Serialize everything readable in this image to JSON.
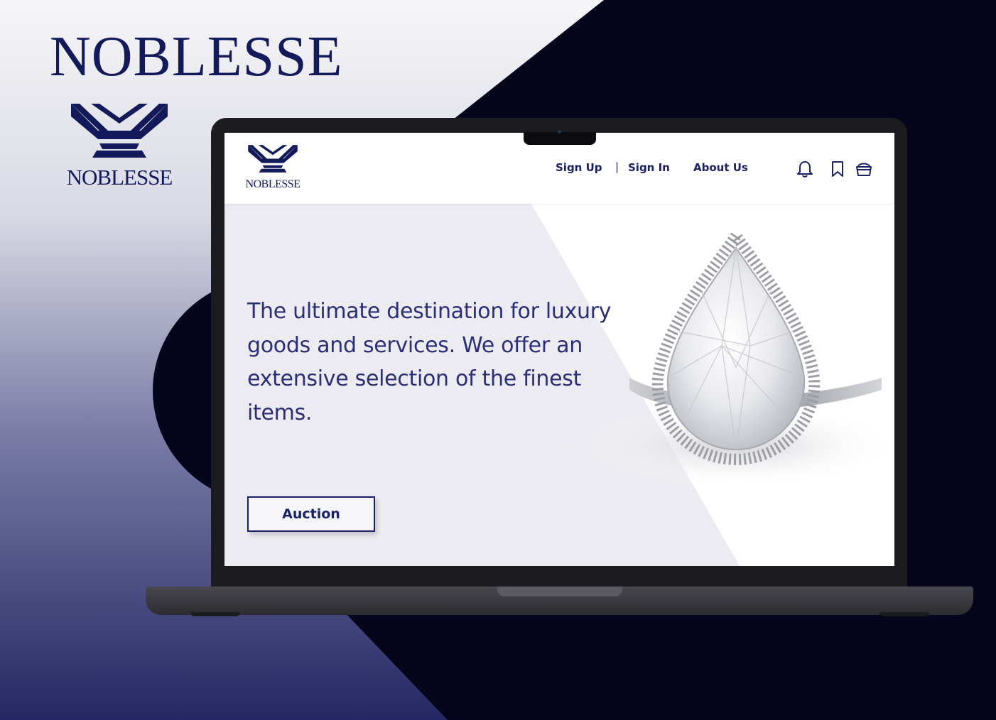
{
  "brand": {
    "title": "NOBLESSE",
    "logo_text": "NOBLESSE"
  },
  "site": {
    "logo_text": "NOBLESSE",
    "nav": {
      "sign_up": "Sign  Up",
      "separator": "|",
      "sign_in": "Sign In",
      "about": "About Us"
    },
    "icons": [
      "bell-icon",
      "bookmark-icon",
      "cart-icon"
    ],
    "hero_text": "The ultimate destination for luxury goods and services. We offer an extensive selection of the finest items.",
    "cta_label": "Auction"
  },
  "colors": {
    "navy": "#131a5a",
    "dark_bg": "#05061c",
    "screen_bg": "#ecebf1"
  }
}
